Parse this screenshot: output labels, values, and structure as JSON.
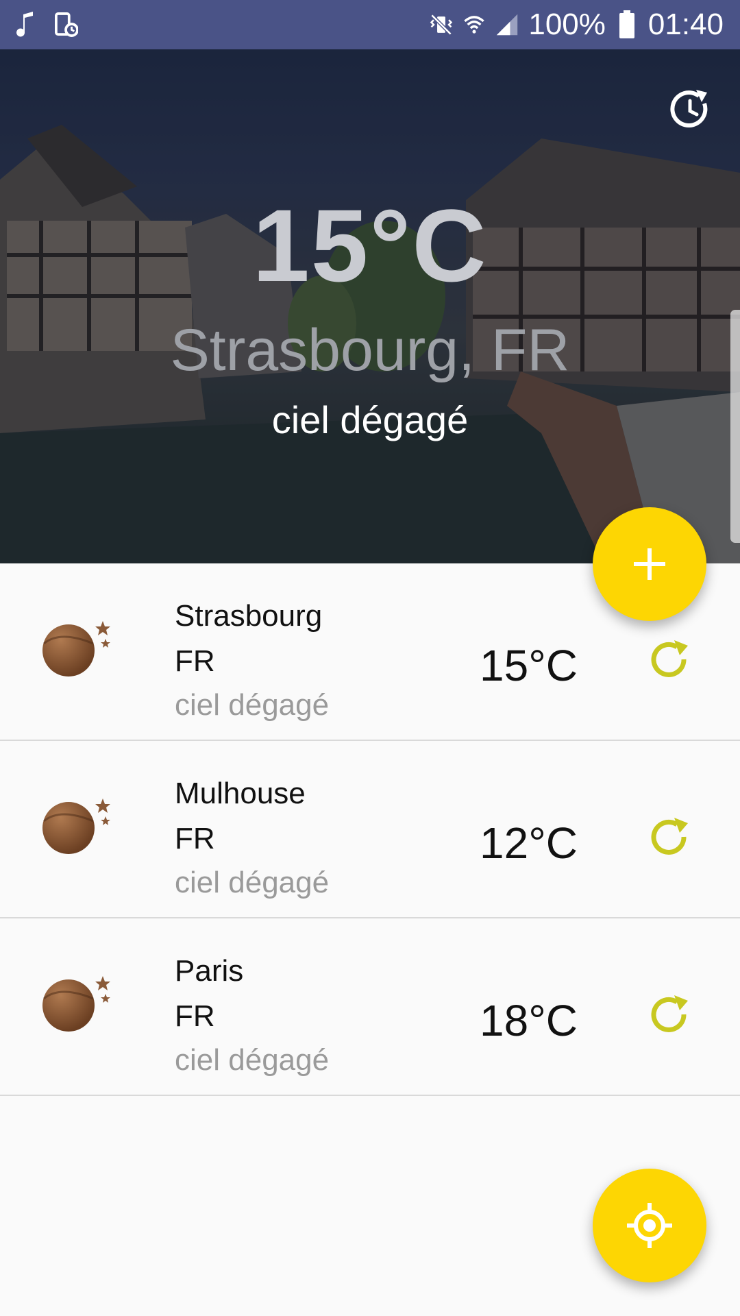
{
  "status_bar": {
    "battery": "100%",
    "time": "01:40",
    "icons": [
      "music-note-icon",
      "screen-timer-icon",
      "vibrate-mute-icon",
      "wifi-icon",
      "signal-icon",
      "battery-icon"
    ]
  },
  "hero": {
    "temperature": "15°C",
    "location": "Strasbourg, FR",
    "description": "ciel dégagé"
  },
  "cities": [
    {
      "city": "Strasbourg",
      "country": "FR",
      "description": "ciel dégagé",
      "temperature": "15°C"
    },
    {
      "city": "Mulhouse",
      "country": "FR",
      "description": "ciel dégagé",
      "temperature": "12°C"
    },
    {
      "city": "Paris",
      "country": "FR",
      "description": "ciel dégagé",
      "temperature": "18°C"
    }
  ],
  "colors": {
    "status_bar": "#4a5387",
    "fab": "#fdd603",
    "refresh_icon": "#c8c820",
    "moon": "#8a5a38"
  }
}
